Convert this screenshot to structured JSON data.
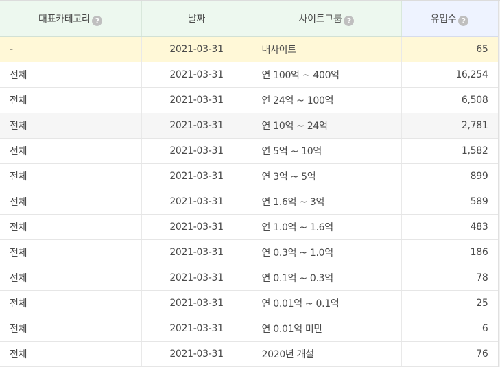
{
  "headers": [
    {
      "label": "대표카테고리",
      "help": true
    },
    {
      "label": "날짜",
      "help": false
    },
    {
      "label": "사이트그룹",
      "help": true
    },
    {
      "label": "유입수",
      "help": true
    }
  ],
  "help_glyph": "?",
  "colors": {
    "header_bg": "#edf8ef",
    "header_highlight_bg": "#eef3ff",
    "my_site_row_bg": "#fff8d7",
    "shaded_row_bg": "#f6f6f6",
    "help_icon": "#bfbfbf",
    "text": "#4a4a4a"
  },
  "rows": [
    {
      "category": "-",
      "date": "2021-03-31",
      "site_group": "내사이트",
      "visits": "65"
    },
    {
      "category": "전체",
      "date": "2021-03-31",
      "site_group": "연 100억 ~ 400억",
      "visits": "16,254"
    },
    {
      "category": "전체",
      "date": "2021-03-31",
      "site_group": "연 24억 ~ 100억",
      "visits": "6,508"
    },
    {
      "category": "전체",
      "date": "2021-03-31",
      "site_group": "연 10억 ~ 24억",
      "visits": "2,781"
    },
    {
      "category": "전체",
      "date": "2021-03-31",
      "site_group": "연 5억 ~ 10억",
      "visits": "1,582"
    },
    {
      "category": "전체",
      "date": "2021-03-31",
      "site_group": "연 3억 ~ 5억",
      "visits": "899"
    },
    {
      "category": "전체",
      "date": "2021-03-31",
      "site_group": "연 1.6억 ~ 3억",
      "visits": "589"
    },
    {
      "category": "전체",
      "date": "2021-03-31",
      "site_group": "연 1.0억 ~ 1.6억",
      "visits": "483"
    },
    {
      "category": "전체",
      "date": "2021-03-31",
      "site_group": "연 0.3억 ~ 1.0억",
      "visits": "186"
    },
    {
      "category": "전체",
      "date": "2021-03-31",
      "site_group": "연 0.1억 ~ 0.3억",
      "visits": "78"
    },
    {
      "category": "전체",
      "date": "2021-03-31",
      "site_group": "연 0.01억 ~ 0.1억",
      "visits": "25"
    },
    {
      "category": "전체",
      "date": "2021-03-31",
      "site_group": "연 0.01억 미만",
      "visits": "6"
    },
    {
      "category": "전체",
      "date": "2021-03-31",
      "site_group": "2020년 개설",
      "visits": "76"
    }
  ]
}
